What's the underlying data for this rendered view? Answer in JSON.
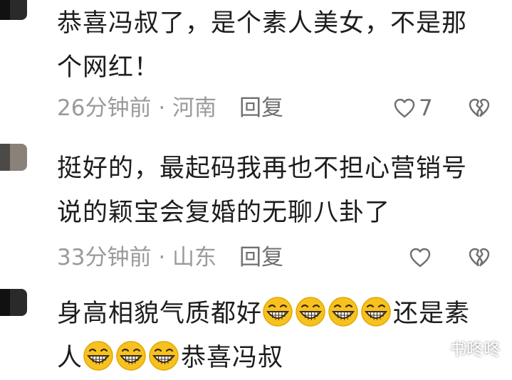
{
  "comments": [
    {
      "text_line1": "恭喜冯叔了，是个素人美女，不是那",
      "text_line2": "个网红！",
      "time": "26分钟前",
      "location": "河南",
      "reply_label": "回复",
      "like_count": "7"
    },
    {
      "text_line1": "挺好的，最起码我再也不担心营销号",
      "text_line2": "说的颖宝会复婚的无聊八卦了",
      "time": "33分钟前",
      "location": "山东",
      "reply_label": "回复",
      "like_count": ""
    },
    {
      "text_part1": "身高相貌气质都好",
      "text_part2": "还是素",
      "text_part3": "人",
      "text_part4": "恭喜冯叔",
      "emoji_name": "grinning-face-emoji"
    }
  ],
  "separator": "·",
  "icons": {
    "like": "heart-outline-icon",
    "dislike": "broken-heart-icon"
  },
  "watermark": "书咚咚",
  "colors": {
    "text": "#1d1d1d",
    "meta": "#9a9a9a",
    "action": "#6f6f6f",
    "emoji_face": "#f7c21f"
  }
}
